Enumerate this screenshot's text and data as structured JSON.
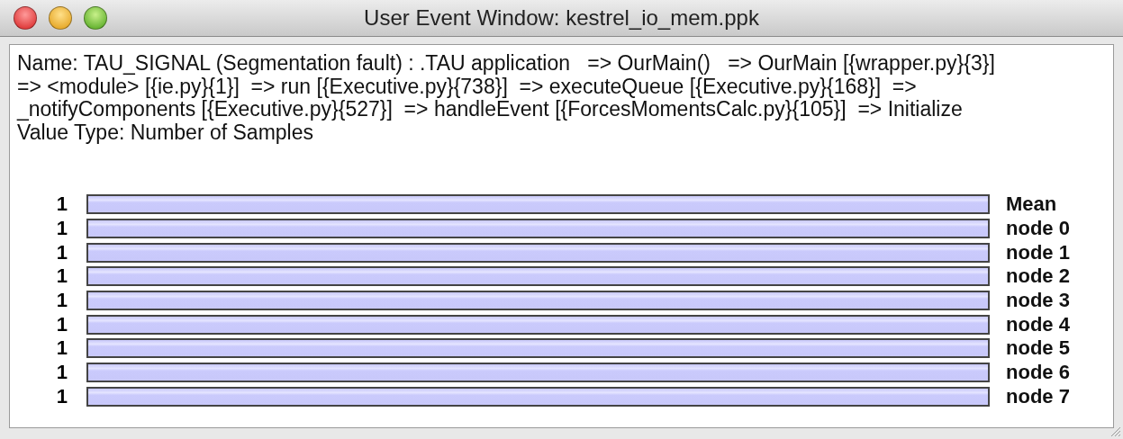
{
  "window": {
    "title": "User Event Window: kestrel_io_mem.ppk"
  },
  "name_lines": [
    "Name: TAU_SIGNAL (Segmentation fault) : .TAU application   => OurMain()   => OurMain [{wrapper.py}{3}]",
    "=> <module> [{ie.py}{1}]  => run [{Executive.py}{738}]  => executeQueue [{Executive.py}{168}]  =>",
    "_notifyComponents [{Executive.py}{527}]  => handleEvent [{ForcesMomentsCalc.py}{105}]  => Initialize"
  ],
  "value_type": "Value Type: Number of Samples",
  "rows": [
    {
      "value": "1",
      "label": "Mean"
    },
    {
      "value": "1",
      "label": "node 0"
    },
    {
      "value": "1",
      "label": "node 1"
    },
    {
      "value": "1",
      "label": "node 2"
    },
    {
      "value": "1",
      "label": "node 3"
    },
    {
      "value": "1",
      "label": "node 4"
    },
    {
      "value": "1",
      "label": "node 5"
    },
    {
      "value": "1",
      "label": "node 6"
    },
    {
      "value": "1",
      "label": "node 7"
    }
  ]
}
